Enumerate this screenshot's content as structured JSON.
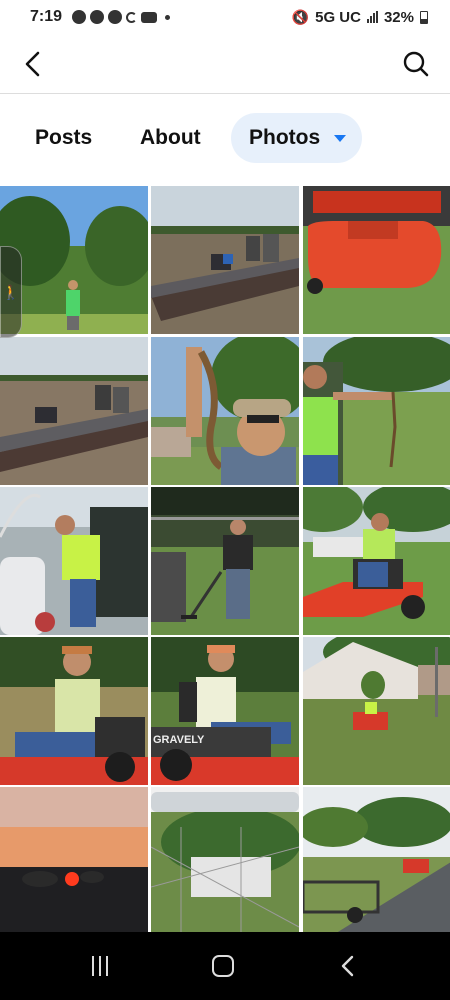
{
  "status_bar": {
    "time": "7:19",
    "network": "5G UC",
    "battery": "32%",
    "icons": [
      "messenger-icon",
      "facebook-icon",
      "chrome-icon",
      "sync-icon",
      "youtube-icon",
      "notification-dot-icon",
      "mute-icon",
      "signal-icon",
      "battery-icon"
    ]
  },
  "header": {
    "back_icon": "back-arrow-icon",
    "search_icon": "search-icon"
  },
  "tabs": [
    {
      "label": "Posts",
      "selected": false
    },
    {
      "label": "About",
      "selected": false
    },
    {
      "label": "Photos",
      "selected": true
    }
  ],
  "accent_color": "#1877f2",
  "photos": [
    {
      "subject": "man in green shirt standing in a field"
    },
    {
      "subject": "bass boat on a lake"
    },
    {
      "subject": "red riding mower deck"
    },
    {
      "subject": "bass boat on a lake"
    },
    {
      "subject": "man holding a snake"
    },
    {
      "subject": "person in green shirt holding a snake"
    },
    {
      "subject": "person in green shirt next to a boat"
    },
    {
      "subject": "man using a string trimmer"
    },
    {
      "subject": "woman on a red zero-turn mower"
    },
    {
      "subject": "woman on a red zero-turn mower"
    },
    {
      "subject": "woman on a Gravely mower",
      "label": "GRAVELY"
    },
    {
      "subject": "mowing lawn by a building"
    },
    {
      "subject": "sunset over trees"
    },
    {
      "subject": "pipe and fence in yard"
    },
    {
      "subject": "trailer on a road"
    }
  ],
  "nav_bar": {
    "icons": [
      "recent-apps-icon",
      "home-icon",
      "back-icon"
    ]
  }
}
